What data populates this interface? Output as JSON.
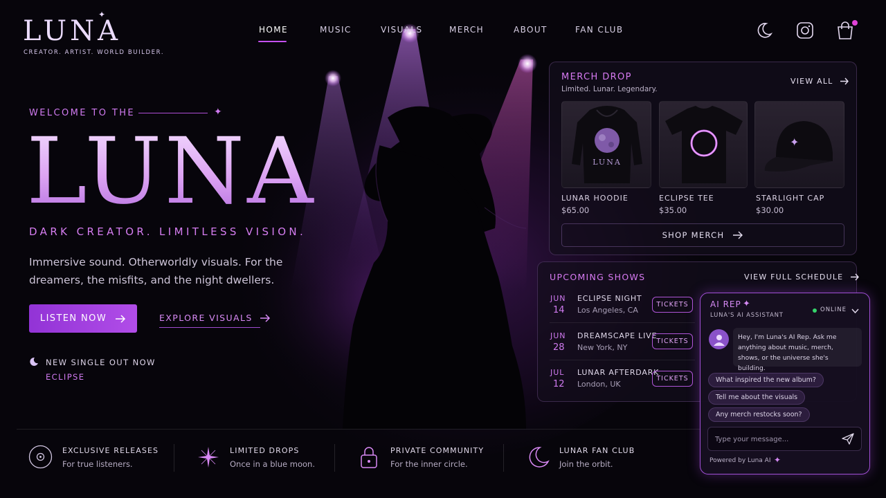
{
  "brand": {
    "logo": "LUNA",
    "tagline": "CREATOR. ARTIST. WORLD BUILDER."
  },
  "nav": {
    "items": [
      "HOME",
      "MUSIC",
      "VISUALS",
      "MERCH",
      "ABOUT",
      "FAN CLUB"
    ],
    "active": "HOME"
  },
  "header_icons": [
    "moon-icon",
    "instagram-icon",
    "shopping-bag-icon"
  ],
  "hero": {
    "welcome": "WELCOME TO THE",
    "title": "LUNA",
    "subtitle": "DARK CREATOR. LIMITLESS VISION.",
    "description": "Immersive sound. Otherworldly visuals. For the dreamers, the misfits, and the night dwellers.",
    "listen_button": "LISTEN NOW",
    "explore_link": "EXPLORE VISUALS",
    "single_label": "NEW SINGLE OUT NOW",
    "single_name": "ECLIPSE"
  },
  "merch": {
    "title": "MERCH DROP",
    "subtitle": "Limited. Lunar. Legendary.",
    "view_all": "VIEW ALL",
    "products": [
      {
        "name": "LUNAR HOODIE",
        "price": "$65.00",
        "print": "LUNA"
      },
      {
        "name": "ECLIPSE TEE",
        "price": "$35.00"
      },
      {
        "name": "STARLIGHT CAP",
        "price": "$30.00"
      }
    ],
    "shop_button": "SHOP MERCH"
  },
  "shows": {
    "title": "UPCOMING SHOWS",
    "full_schedule": "VIEW FULL SCHEDULE",
    "ticket_label": "TICKETS",
    "items": [
      {
        "month": "JUN",
        "day": "14",
        "name": "ECLIPSE NIGHT",
        "city": "Los Angeles, CA"
      },
      {
        "month": "JUN",
        "day": "28",
        "name": "DREAMSCAPE LIVE",
        "city": "New York, NY"
      },
      {
        "month": "JUL",
        "day": "12",
        "name": "LUNAR AFTERDARK",
        "city": "London, UK"
      }
    ]
  },
  "chat": {
    "title": "AI REP",
    "subtitle": "LUNA'S AI ASSISTANT",
    "status": "ONLINE",
    "status_color": "#35d46b",
    "greeting": "Hey, I'm Luna's AI Rep. Ask me anything about music, merch, shows, or the universe she's building.",
    "suggestions": [
      "What inspired the new album?",
      "Tell me about the visuals",
      "Any merch restocks soon?"
    ],
    "input_placeholder": "Type your message...",
    "powered_by": "Powered by Luna AI"
  },
  "features": [
    {
      "icon": "vinyl-icon",
      "title": "EXCLUSIVE RELEASES",
      "subtitle": "For true listeners."
    },
    {
      "icon": "sparkle-icon",
      "title": "LIMITED DROPS",
      "subtitle": "Once in a blue moon."
    },
    {
      "icon": "lock-icon",
      "title": "PRIVATE COMMUNITY",
      "subtitle": "For the inner circle."
    },
    {
      "icon": "crescent-moon-icon",
      "title": "LUNAR FAN CLUB",
      "subtitle": "Join the orbit."
    }
  ],
  "colors": {
    "accent": "#c450f0",
    "accent_text": "#d07af0",
    "background": "#07050b",
    "button": "#9233d6"
  }
}
